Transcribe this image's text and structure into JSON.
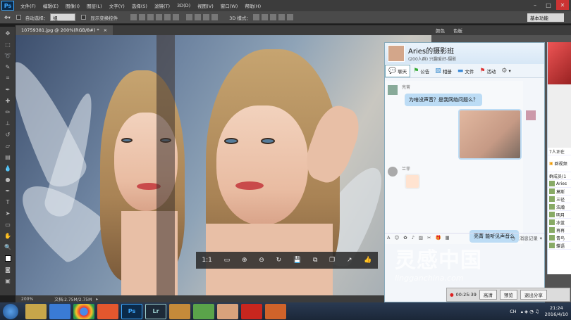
{
  "ps": {
    "logo": "Ps",
    "menu": [
      "文件(F)",
      "编辑(E)",
      "图像(I)",
      "图层(L)",
      "文字(Y)",
      "选择(S)",
      "滤镜(T)",
      "3D(D)",
      "视图(V)",
      "窗口(W)",
      "帮助(H)"
    ],
    "options": {
      "auto_select_label": "自动选择：",
      "auto_select_value": "组",
      "show_transform_label": "显示变换控件",
      "mode_label": "3D 模式："
    },
    "workspace": "基本功能",
    "document_tab": "10759381.jpg @ 200%(RGB/8#) *",
    "panel_tabs": [
      "颜色",
      "色板"
    ],
    "status": {
      "zoom": "200%",
      "doc": "文档:2.75M/2.75M"
    }
  },
  "viewer": {
    "ratio_label": "1:1"
  },
  "qq": {
    "group_name": "Aries的摄影班",
    "group_sub": "(200人群) 兴趣爱好-摄影",
    "tabs": [
      "聊天",
      "公告",
      "相册",
      "文件",
      "活动"
    ],
    "msg1_name": "亮菁",
    "msg1_text": "为啥没声音？是我网络问题么？",
    "msg2_name": "兰菲",
    "msg3_text": "亮菁 能听见声音么",
    "toolbar_left": "A",
    "history_label": "消息记录",
    "side": {
      "count_label": "7人正在",
      "video_label": "群视频",
      "members_label": "群成员(1",
      "members": [
        "Aries",
        "莫斯",
        "三径",
        "浩瀚",
        "明月",
        "冰蓝",
        "再再",
        "青鸟",
        "蝶语"
      ]
    }
  },
  "recording": {
    "time": "00:25:39",
    "hd": "高清",
    "preview": "预览",
    "exit": "退出分享"
  },
  "watermark": {
    "cn": "灵感中国",
    "en": "lingganchina.com"
  },
  "taskbar": {
    "apps": [
      "Ps",
      "Lr"
    ],
    "lang": "CH",
    "time": "21:24",
    "date": "2016/4/10"
  }
}
